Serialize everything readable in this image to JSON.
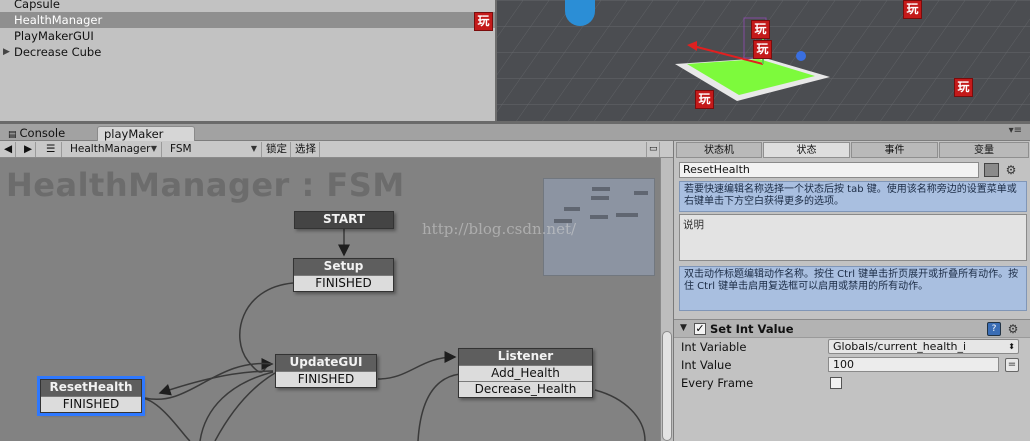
{
  "hierarchy": {
    "items": [
      {
        "label": "Capsule",
        "selected": false,
        "has_children": false
      },
      {
        "label": "HealthManager",
        "selected": true,
        "has_children": false
      },
      {
        "label": "PlayMakerGUI",
        "selected": false,
        "has_children": false
      },
      {
        "label": "Decrease Cube",
        "selected": false,
        "has_children": true
      }
    ]
  },
  "badge_glyph": "玩",
  "tabs": {
    "console": "Console",
    "playmaker": "playMaker"
  },
  "toolbar": {
    "fsm_owner": "HealthManager",
    "fsm_name": "FSM",
    "lock": "锁定",
    "select": "选择"
  },
  "graph": {
    "title": "HealthManager : FSM",
    "watermark": "http://blog.csdn.net/",
    "states": {
      "start": {
        "title": "START"
      },
      "setup": {
        "title": "Setup",
        "events": [
          "FINISHED"
        ]
      },
      "update_gui": {
        "title": "UpdateGUI",
        "events": [
          "FINISHED"
        ]
      },
      "listener": {
        "title": "Listener",
        "events": [
          "Add_Health",
          "Decrease_Health"
        ]
      },
      "reset_health": {
        "title": "ResetHealth",
        "events": [
          "FINISHED"
        ]
      }
    }
  },
  "inspector": {
    "tabs": [
      "状态机",
      "状态",
      "事件",
      "变量"
    ],
    "active_tab": "状态",
    "state_name": "ResetHealth",
    "hint_top": "若要快速编辑名称选择一个状态后按 tab 键。使用该名称旁边的设置菜单或右键单击下方空白获得更多的选项。",
    "description_placeholder": "说明",
    "hint_actions": "双击动作标题编辑动作名称。按住 Ctrl 键单击折页展开或折叠所有动作。按住 Ctrl 键单击启用复选框可以启用或禁用的所有动作。",
    "action": {
      "title": "Set Int Value",
      "enabled": true,
      "props": {
        "int_variable_label": "Int Variable",
        "int_variable_value": "Globals/current_health_i",
        "int_value_label": "Int Value",
        "int_value_value": "100",
        "every_frame_label": "Every Frame",
        "every_frame_checked": false
      }
    }
  },
  "colors": {
    "selected_state_outline": "#2e78ff",
    "play_badge": "#c41a1a",
    "hint_box": "#a9bfe0",
    "scene_plane": "#7dfa3c"
  }
}
